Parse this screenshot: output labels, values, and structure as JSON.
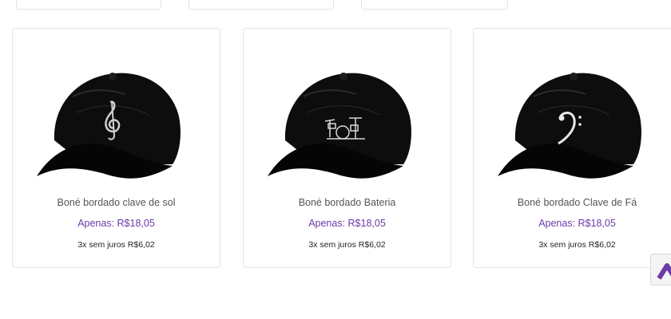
{
  "products": [
    {
      "name": "Boné bordado clave de sol",
      "price": "Apenas: R$18,05",
      "installments": "3x sem juros R$6,02"
    },
    {
      "name": "Boné bordado Bateria",
      "price": "Apenas: R$18,05",
      "installments": "3x sem juros R$6,02"
    },
    {
      "name": "Boné bordado Clave de Fá",
      "price": "Apenas: R$18,05",
      "installments": "3x sem juros R$6,02"
    }
  ],
  "colors": {
    "accent": "#6b3aa6",
    "cap": "#0d0d0d",
    "text": "#555555"
  },
  "icons": {
    "embroidery_1": "treble-clef-icon",
    "embroidery_2": "drum-kit-icon",
    "embroidery_3": "bass-clef-icon",
    "scroll": "chevron-up-icon"
  }
}
